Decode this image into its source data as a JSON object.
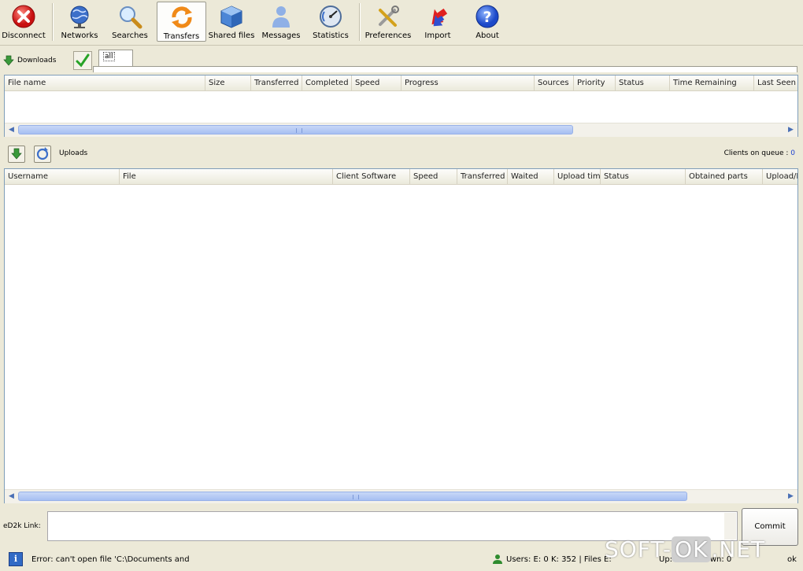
{
  "toolbar": {
    "items": [
      {
        "label": "Disconnect"
      },
      {
        "label": "Networks"
      },
      {
        "label": "Searches"
      },
      {
        "label": "Transfers"
      },
      {
        "label": "Shared files"
      },
      {
        "label": "Messages"
      },
      {
        "label": "Statistics"
      },
      {
        "label": "Preferences"
      },
      {
        "label": "Import"
      },
      {
        "label": "About"
      }
    ],
    "active": "Transfers"
  },
  "downloads": {
    "button_label": "Downloads",
    "filter_tab": "all",
    "columns": [
      "File name",
      "Size",
      "Transferred",
      "Completed",
      "Speed",
      "Progress",
      "Sources",
      "Priority",
      "Status",
      "Time Remaining",
      "Last Seen"
    ]
  },
  "uploads": {
    "label": "Uploads",
    "clients_queue_label": "Clients on queue :",
    "clients_queue_value": "0",
    "columns": [
      "Username",
      "File",
      "Client Software",
      "Speed",
      "Transferred",
      "Waited",
      "Upload time",
      "Status",
      "Obtained parts",
      "Upload/D"
    ]
  },
  "ed2k": {
    "label": "eD2k Link:",
    "value": "",
    "commit_label": "Commit"
  },
  "statusbar": {
    "message": "Error: can't open file 'C:\\Documents and",
    "users": "Users: E: 0 K: 352 | Files E:",
    "up": "Up: 0",
    "down": "Down: 0",
    "extra": "ok"
  },
  "watermark": {
    "part1": "SOFT-",
    "part2": "OK",
    "part3": ".NET"
  },
  "colors": {
    "accent": "#316ac5",
    "scroll_thumb": "#a6bff2",
    "clients_value": "#1a3fd1"
  }
}
